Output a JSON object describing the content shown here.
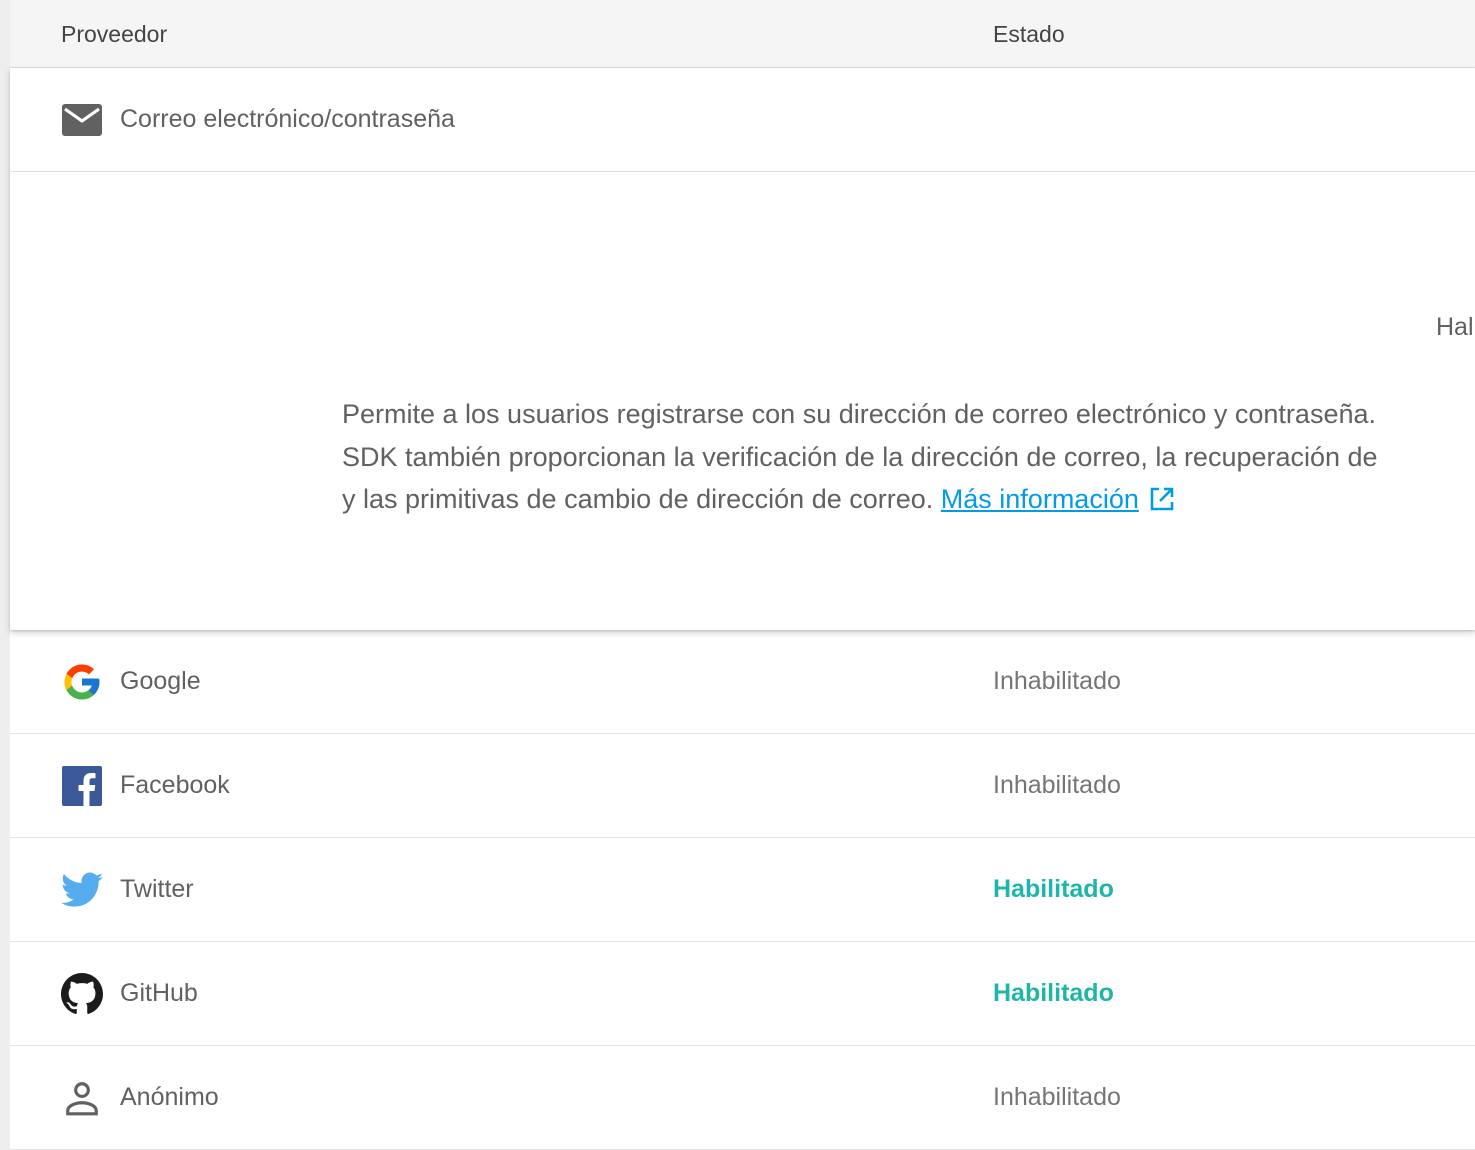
{
  "header": {
    "provider_col": "Proveedor",
    "status_col": "Estado"
  },
  "email": {
    "label": "Correo electrónico/contraseña",
    "icon": "mail-icon",
    "enable_label_partial": "Hal",
    "description_line1": "Permite a los usuarios registrarse con su dirección de correo electrónico y contraseña.",
    "description_line2": "SDK también proporcionan la verificación de la dirección de correo, la recuperación de",
    "description_line3": "y las primitivas de cambio de dirección de correo.",
    "learn_more": "Más información"
  },
  "providers": [
    {
      "label": "Google",
      "icon": "google-icon",
      "status": "Inhabilitado"
    },
    {
      "label": "Facebook",
      "icon": "facebook-icon",
      "status": "Inhabilitado"
    },
    {
      "label": "Twitter",
      "icon": "twitter-icon",
      "status": "Habilitado"
    },
    {
      "label": "GitHub",
      "icon": "github-icon",
      "status": "Habilitado"
    },
    {
      "label": "Anónimo",
      "icon": "person-icon",
      "status": "Inhabilitado"
    }
  ],
  "colors": {
    "enabled": "#1eb6a9",
    "link": "#039be5",
    "text": "#616161"
  }
}
